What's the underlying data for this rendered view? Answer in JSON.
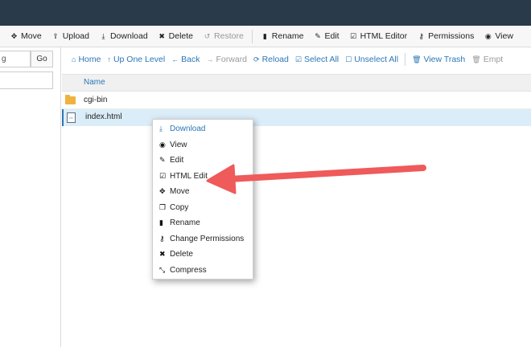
{
  "toolbar": {
    "items": [
      {
        "label": "Move",
        "icon": "move-icon",
        "glyph": "✥"
      },
      {
        "label": "Upload",
        "icon": "upload-icon",
        "glyph": "⇪"
      },
      {
        "label": "Download",
        "icon": "download-icon",
        "glyph": "⤓"
      },
      {
        "label": "Delete",
        "icon": "delete-icon",
        "glyph": "✖"
      },
      {
        "label": "Restore",
        "icon": "restore-icon",
        "glyph": "↺"
      },
      {
        "label": "Rename",
        "icon": "rename-icon",
        "glyph": "▮"
      },
      {
        "label": "Edit",
        "icon": "edit-icon",
        "glyph": "✎"
      },
      {
        "label": "HTML Editor",
        "icon": "html-editor-icon",
        "glyph": "☑"
      },
      {
        "label": "Permissions",
        "icon": "permissions-icon",
        "glyph": "⚷"
      },
      {
        "label": "View",
        "icon": "view-icon",
        "glyph": "◉"
      }
    ]
  },
  "left_panel": {
    "path_input_value": "g",
    "go_label": "Go"
  },
  "navbar": {
    "items": [
      {
        "label": "Home",
        "icon": "home-icon",
        "glyph": "⌂"
      },
      {
        "label": "Up One Level",
        "icon": "up-level-icon",
        "glyph": "↑"
      },
      {
        "label": "Back",
        "icon": "back-icon",
        "glyph": "←"
      },
      {
        "label": "Forward",
        "icon": "forward-icon",
        "glyph": "→"
      },
      {
        "label": "Reload",
        "icon": "reload-icon",
        "glyph": "⟳"
      },
      {
        "label": "Select All",
        "icon": "select-all-icon",
        "glyph": "☑"
      },
      {
        "label": "Unselect All",
        "icon": "unselect-all-icon",
        "glyph": "☐"
      },
      {
        "label": "View Trash",
        "icon": "trash-icon",
        "glyph": "🗑"
      },
      {
        "label": "Empt",
        "icon": "empty-trash-icon",
        "glyph": "🗑"
      }
    ]
  },
  "file_list": {
    "name_header": "Name",
    "rows": [
      {
        "name": "cgi-bin",
        "type": "folder"
      },
      {
        "name": "index.html",
        "type": "file",
        "selected": true
      }
    ]
  },
  "context_menu": {
    "items": [
      {
        "label": "Download",
        "icon": "download-icon",
        "glyph": "⤓"
      },
      {
        "label": "View",
        "icon": "view-icon",
        "glyph": "◉"
      },
      {
        "label": "Edit",
        "icon": "edit-icon",
        "glyph": "✎"
      },
      {
        "label": "HTML Edit",
        "icon": "html-edit-icon",
        "glyph": "☑"
      },
      {
        "label": "Move",
        "icon": "move-icon",
        "glyph": "✥"
      },
      {
        "label": "Copy",
        "icon": "copy-icon",
        "glyph": "❐"
      },
      {
        "label": "Rename",
        "icon": "rename-icon",
        "glyph": "▮"
      },
      {
        "label": "Change Permissions",
        "icon": "permissions-icon",
        "glyph": "⚷"
      },
      {
        "label": "Delete",
        "icon": "delete-icon",
        "glyph": "✖"
      },
      {
        "label": "Compress",
        "icon": "compress-icon",
        "glyph": "⤡"
      }
    ]
  },
  "colors": {
    "topbar": "#293a4a",
    "link": "#2a77b7",
    "selected_row": "#dbedf8",
    "annotation_arrow": "#ef5a5a"
  }
}
